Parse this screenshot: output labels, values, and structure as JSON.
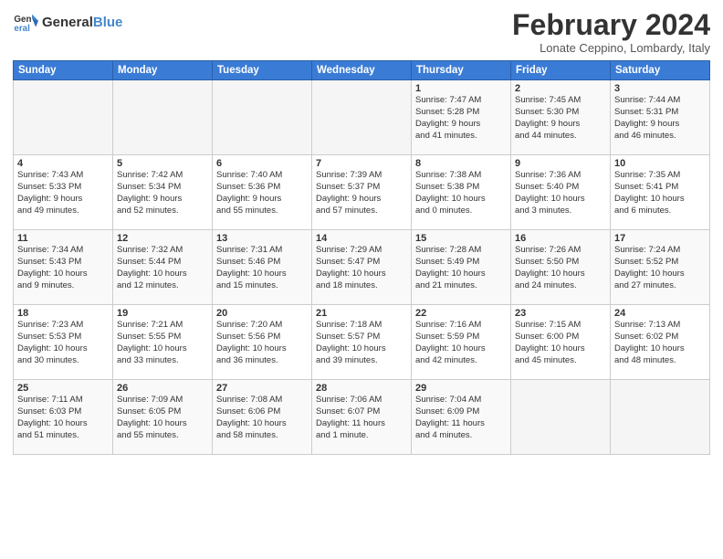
{
  "header": {
    "logo_general": "General",
    "logo_blue": "Blue",
    "month": "February 2024",
    "location": "Lonate Ceppino, Lombardy, Italy"
  },
  "weekdays": [
    "Sunday",
    "Monday",
    "Tuesday",
    "Wednesday",
    "Thursday",
    "Friday",
    "Saturday"
  ],
  "weeks": [
    [
      {
        "day": "",
        "content": ""
      },
      {
        "day": "",
        "content": ""
      },
      {
        "day": "",
        "content": ""
      },
      {
        "day": "",
        "content": ""
      },
      {
        "day": "1",
        "content": "Sunrise: 7:47 AM\nSunset: 5:28 PM\nDaylight: 9 hours\nand 41 minutes."
      },
      {
        "day": "2",
        "content": "Sunrise: 7:45 AM\nSunset: 5:30 PM\nDaylight: 9 hours\nand 44 minutes."
      },
      {
        "day": "3",
        "content": "Sunrise: 7:44 AM\nSunset: 5:31 PM\nDaylight: 9 hours\nand 46 minutes."
      }
    ],
    [
      {
        "day": "4",
        "content": "Sunrise: 7:43 AM\nSunset: 5:33 PM\nDaylight: 9 hours\nand 49 minutes."
      },
      {
        "day": "5",
        "content": "Sunrise: 7:42 AM\nSunset: 5:34 PM\nDaylight: 9 hours\nand 52 minutes."
      },
      {
        "day": "6",
        "content": "Sunrise: 7:40 AM\nSunset: 5:36 PM\nDaylight: 9 hours\nand 55 minutes."
      },
      {
        "day": "7",
        "content": "Sunrise: 7:39 AM\nSunset: 5:37 PM\nDaylight: 9 hours\nand 57 minutes."
      },
      {
        "day": "8",
        "content": "Sunrise: 7:38 AM\nSunset: 5:38 PM\nDaylight: 10 hours\nand 0 minutes."
      },
      {
        "day": "9",
        "content": "Sunrise: 7:36 AM\nSunset: 5:40 PM\nDaylight: 10 hours\nand 3 minutes."
      },
      {
        "day": "10",
        "content": "Sunrise: 7:35 AM\nSunset: 5:41 PM\nDaylight: 10 hours\nand 6 minutes."
      }
    ],
    [
      {
        "day": "11",
        "content": "Sunrise: 7:34 AM\nSunset: 5:43 PM\nDaylight: 10 hours\nand 9 minutes."
      },
      {
        "day": "12",
        "content": "Sunrise: 7:32 AM\nSunset: 5:44 PM\nDaylight: 10 hours\nand 12 minutes."
      },
      {
        "day": "13",
        "content": "Sunrise: 7:31 AM\nSunset: 5:46 PM\nDaylight: 10 hours\nand 15 minutes."
      },
      {
        "day": "14",
        "content": "Sunrise: 7:29 AM\nSunset: 5:47 PM\nDaylight: 10 hours\nand 18 minutes."
      },
      {
        "day": "15",
        "content": "Sunrise: 7:28 AM\nSunset: 5:49 PM\nDaylight: 10 hours\nand 21 minutes."
      },
      {
        "day": "16",
        "content": "Sunrise: 7:26 AM\nSunset: 5:50 PM\nDaylight: 10 hours\nand 24 minutes."
      },
      {
        "day": "17",
        "content": "Sunrise: 7:24 AM\nSunset: 5:52 PM\nDaylight: 10 hours\nand 27 minutes."
      }
    ],
    [
      {
        "day": "18",
        "content": "Sunrise: 7:23 AM\nSunset: 5:53 PM\nDaylight: 10 hours\nand 30 minutes."
      },
      {
        "day": "19",
        "content": "Sunrise: 7:21 AM\nSunset: 5:55 PM\nDaylight: 10 hours\nand 33 minutes."
      },
      {
        "day": "20",
        "content": "Sunrise: 7:20 AM\nSunset: 5:56 PM\nDaylight: 10 hours\nand 36 minutes."
      },
      {
        "day": "21",
        "content": "Sunrise: 7:18 AM\nSunset: 5:57 PM\nDaylight: 10 hours\nand 39 minutes."
      },
      {
        "day": "22",
        "content": "Sunrise: 7:16 AM\nSunset: 5:59 PM\nDaylight: 10 hours\nand 42 minutes."
      },
      {
        "day": "23",
        "content": "Sunrise: 7:15 AM\nSunset: 6:00 PM\nDaylight: 10 hours\nand 45 minutes."
      },
      {
        "day": "24",
        "content": "Sunrise: 7:13 AM\nSunset: 6:02 PM\nDaylight: 10 hours\nand 48 minutes."
      }
    ],
    [
      {
        "day": "25",
        "content": "Sunrise: 7:11 AM\nSunset: 6:03 PM\nDaylight: 10 hours\nand 51 minutes."
      },
      {
        "day": "26",
        "content": "Sunrise: 7:09 AM\nSunset: 6:05 PM\nDaylight: 10 hours\nand 55 minutes."
      },
      {
        "day": "27",
        "content": "Sunrise: 7:08 AM\nSunset: 6:06 PM\nDaylight: 10 hours\nand 58 minutes."
      },
      {
        "day": "28",
        "content": "Sunrise: 7:06 AM\nSunset: 6:07 PM\nDaylight: 11 hours\nand 1 minute."
      },
      {
        "day": "29",
        "content": "Sunrise: 7:04 AM\nSunset: 6:09 PM\nDaylight: 11 hours\nand 4 minutes."
      },
      {
        "day": "",
        "content": ""
      },
      {
        "day": "",
        "content": ""
      }
    ]
  ]
}
